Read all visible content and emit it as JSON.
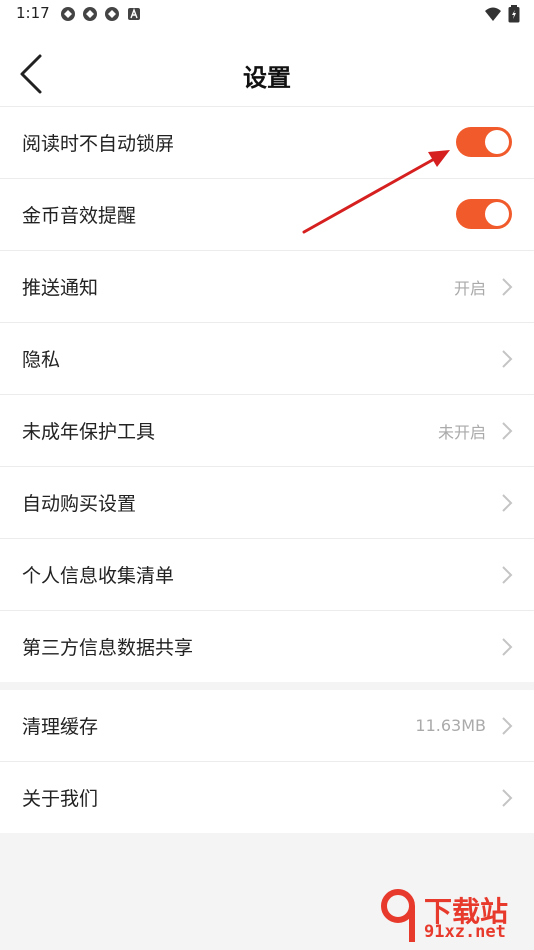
{
  "status_bar": {
    "time": "1:17",
    "icons": [
      "app-notification-icon",
      "app-notification-icon",
      "app-notification-icon",
      "a-icon"
    ],
    "right_icons": [
      "wifi-icon",
      "battery-icon"
    ]
  },
  "header": {
    "title": "设置",
    "back_icon": "back-chevron-icon"
  },
  "settings_group_1": [
    {
      "label": "阅读时不自动锁屏",
      "control": "toggle",
      "on": true
    },
    {
      "label": "金币音效提醒",
      "control": "toggle",
      "on": true
    },
    {
      "label": "推送通知",
      "control": "link",
      "value": "开启"
    },
    {
      "label": "隐私",
      "control": "link",
      "value": ""
    },
    {
      "label": "未成年保护工具",
      "control": "link",
      "value": "未开启"
    },
    {
      "label": "自动购买设置",
      "control": "link",
      "value": ""
    },
    {
      "label": "个人信息收集清单",
      "control": "link",
      "value": ""
    },
    {
      "label": "第三方信息数据共享",
      "control": "link",
      "value": ""
    }
  ],
  "settings_group_2": [
    {
      "label": "清理缓存",
      "control": "link",
      "value": "11.63MB"
    },
    {
      "label": "关于我们",
      "control": "link",
      "value": ""
    }
  ],
  "watermark": {
    "line1": "下载站",
    "line2": "91xz.net"
  },
  "colors": {
    "toggle_on": "#f15a2b",
    "annotation_arrow": "#d62020",
    "watermark": "#e83a2c"
  }
}
